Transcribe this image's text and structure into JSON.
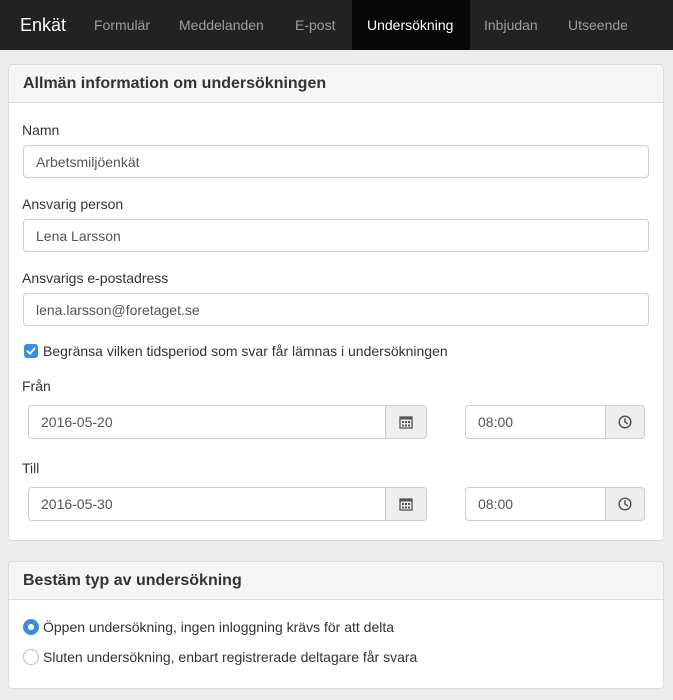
{
  "navbar": {
    "brand": "Enkät",
    "items": [
      {
        "label": "Formulär",
        "active": false
      },
      {
        "label": "Meddelanden",
        "active": false
      },
      {
        "label": "E-post",
        "active": false
      },
      {
        "label": "Undersökning",
        "active": true
      },
      {
        "label": "Inbjudan",
        "active": false
      },
      {
        "label": "Utseende",
        "active": false
      }
    ]
  },
  "info_panel": {
    "title": "Allmän information om undersökningen",
    "name_label": "Namn",
    "name_value": "Arbetsmiljöenkät",
    "person_label": "Ansvarig person",
    "person_value": "Lena Larsson",
    "email_label": "Ansvarigs e-postadress",
    "email_value": "lena.larsson@foretaget.se",
    "limit_checkbox_label": "Begränsa vilken tidsperiod som svar får lämnas i undersökningen",
    "limit_checked": true,
    "from_label": "Från",
    "from_date": "2016-05-20",
    "from_time": "08:00",
    "to_label": "Till",
    "to_date": "2016-05-30",
    "to_time": "08:00",
    "date_icon": "calendar-icon",
    "time_icon": "clock-icon"
  },
  "type_panel": {
    "title": "Bestäm typ av undersökning",
    "options": [
      {
        "label": "Öppen undersökning, ingen inloggning krävs för att delta",
        "selected": true
      },
      {
        "label": "Sluten undersökning, enbart registrerade deltagare får svara",
        "selected": false
      }
    ]
  },
  "colors": {
    "navbar_bg": "#222222",
    "navbar_active_bg": "#080808",
    "accent": "#3b8fd8"
  }
}
